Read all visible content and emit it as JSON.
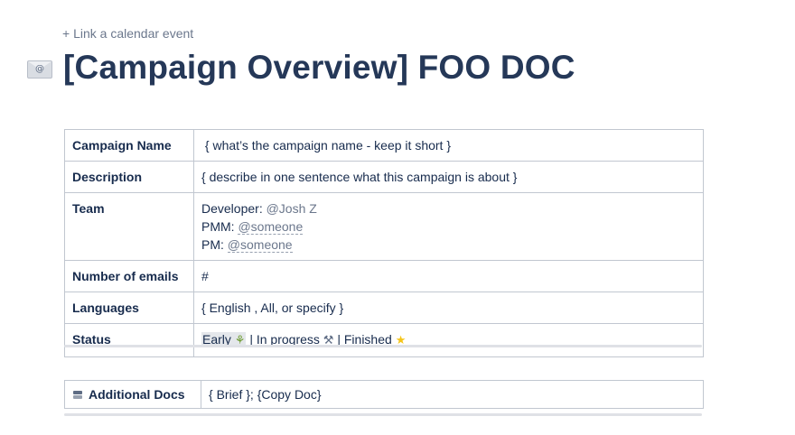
{
  "header": {
    "calendar_link": "+ Link a calendar event",
    "title_icon": "envelope-icon",
    "title": "[Campaign Overview] FOO DOC"
  },
  "info_table": {
    "campaign_name": {
      "label": "Campaign Name",
      "value": "{ what’s the campaign name - keep it short }"
    },
    "description": {
      "label": "Description",
      "value": "{ describe in one sentence what this campaign is about }"
    },
    "team": {
      "label": "Team",
      "developer_label": "Developer: ",
      "developer_mention": "@Josh Z",
      "pmm_label": "PMM: ",
      "pmm_mention": "@someone",
      "pm_label": "PM: ",
      "pm_mention": "@someone"
    },
    "number_of_emails": {
      "label": "Number of emails",
      "value": "#"
    },
    "languages": {
      "label": "Languages",
      "value": "{ English  , All, or specify }"
    },
    "status": {
      "label": "Status",
      "early": "Early",
      "early_icon": "seedling-icon",
      "in_progress": " | In progress ",
      "in_progress_icon": "hammer-icon",
      "finished": " | Finished ",
      "finished_icon": "star-icon"
    }
  },
  "docs_table": {
    "label": "Additional Docs",
    "label_icon": "stack-icon",
    "value": "{ Brief }; {Copy Doc}"
  }
}
